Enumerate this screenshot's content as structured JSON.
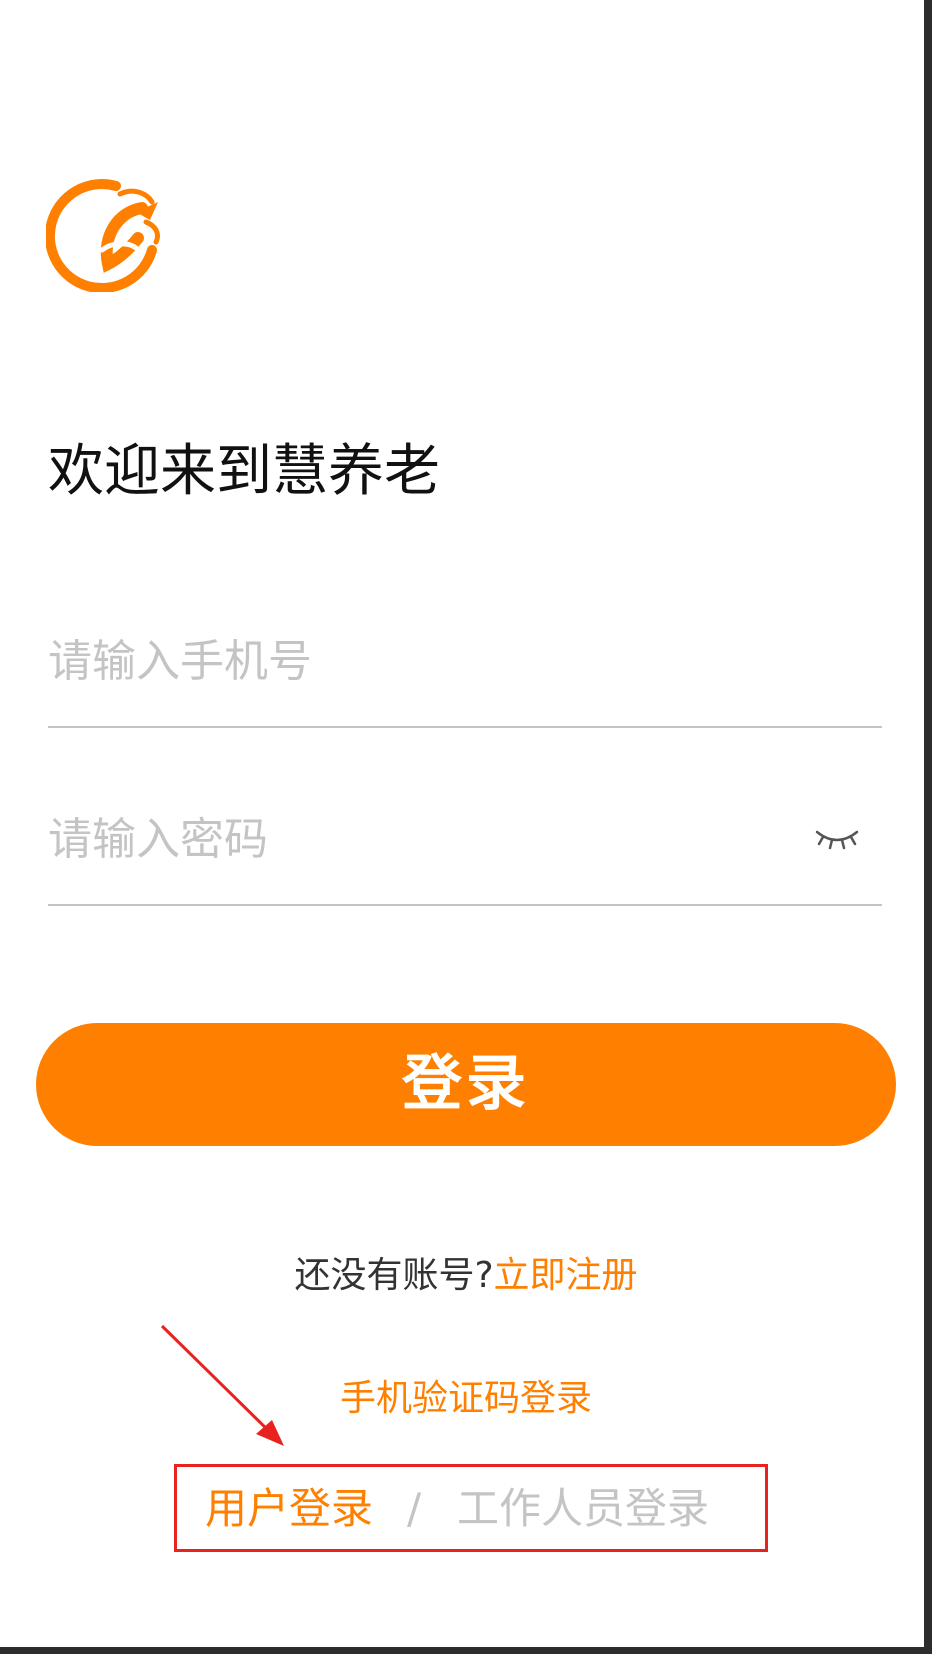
{
  "welcome": {
    "title": "欢迎来到慧养老"
  },
  "form": {
    "phone_placeholder": "请输入手机号",
    "phone_value": "",
    "password_placeholder": "请输入密码",
    "password_value": "",
    "password_visibility_icon": "eye-closed-icon"
  },
  "login_button": {
    "label": "登录"
  },
  "register": {
    "question": "还没有账号?",
    "link": "立即注册"
  },
  "sms_login": {
    "label": "手机验证码登录"
  },
  "role_tabs": {
    "user": "用户登录",
    "divider": "/",
    "staff": "工作人员登录",
    "selected": "user"
  },
  "colors": {
    "accent": "#ff8000",
    "placeholder": "#c4c4c4",
    "annotation": "#e8231f",
    "text": "#111111"
  }
}
